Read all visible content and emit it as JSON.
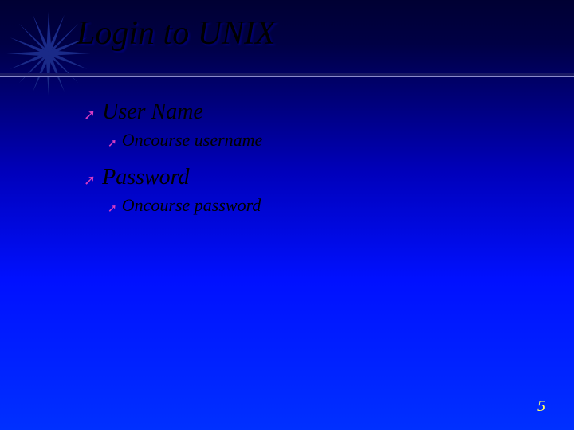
{
  "title": "Login to UNIX",
  "items": [
    {
      "label": "User Name",
      "sub": "Oncourse username"
    },
    {
      "label": "Password",
      "sub": "Oncourse password"
    }
  ],
  "page_number": "5"
}
